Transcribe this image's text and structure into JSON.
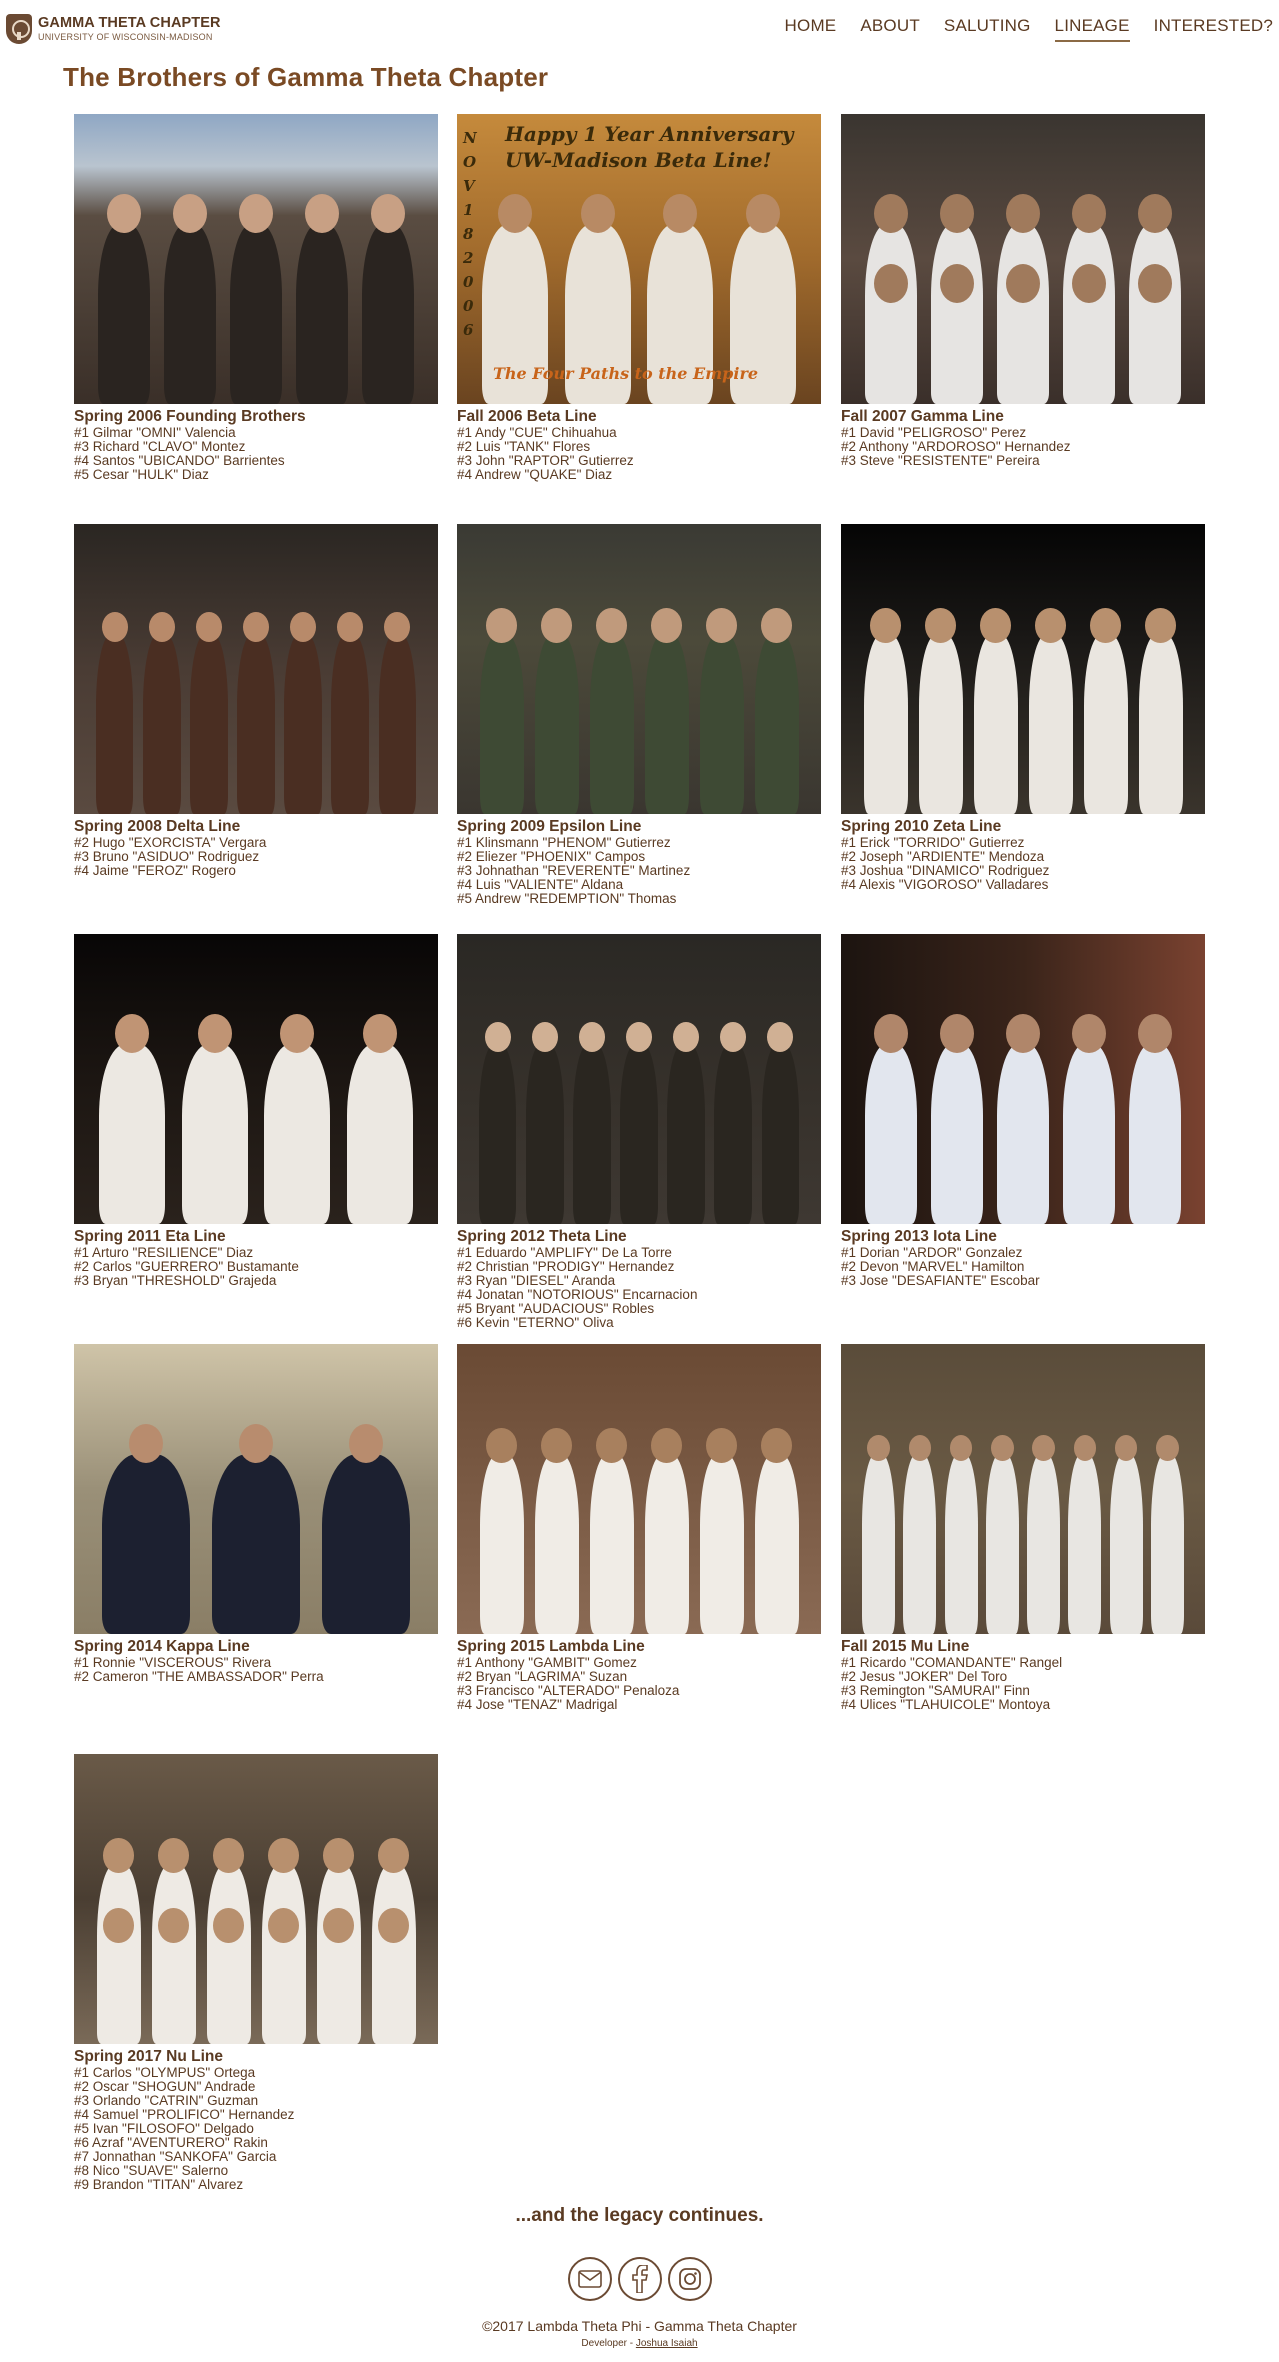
{
  "header": {
    "logo_title": "GAMMA THETA CHAPTER",
    "logo_subtitle": "UNIVERSITY OF WISCONSIN-MADISON",
    "nav": [
      {
        "label": "HOME"
      },
      {
        "label": "ABOUT"
      },
      {
        "label": "SALUTING"
      },
      {
        "label": "LINEAGE",
        "active": true
      },
      {
        "label": "INTERESTED?"
      }
    ]
  },
  "page_title": "The Brothers of Gamma Theta Chapter",
  "photo_text": {
    "banner_line1": "Happy 1 Year Anniversary",
    "banner_line2": "UW-Madison Beta Line!",
    "banner_side": "NOV 18 2006",
    "banner_bottom": "The Four Paths to the Empire"
  },
  "lines": [
    {
      "title": "Spring 2006 Founding Brothers",
      "members": [
        "#1 Gilmar \"OMNI\" Valencia",
        "#3 Richard \"CLAVO\" Montez",
        "#4 Santos \"UBICANDO\" Barrientes",
        "#5 Cesar \"HULK\" Diaz"
      ]
    },
    {
      "title": "Fall 2006 Beta Line",
      "members": [
        "#1 Andy \"CUE\" Chihuahua",
        "#2 Luis \"TANK\" Flores",
        "#3 John \"RAPTOR\" Gutierrez",
        "#4 Andrew \"QUAKE\" Diaz"
      ]
    },
    {
      "title": "Fall 2007 Gamma Line",
      "members": [
        "#1 David \"PELIGROSO\" Perez",
        "#2 Anthony \"ARDOROSO\" Hernandez",
        "#3 Steve \"RESISTENTE\" Pereira"
      ]
    },
    {
      "title": "Spring 2008 Delta Line",
      "members": [
        "#2 Hugo \"EXORCISTA\" Vergara",
        "#3 Bruno \"ASIDUO\" Rodriguez",
        "#4 Jaime \"FEROZ\" Rogero"
      ]
    },
    {
      "title": "Spring 2009 Epsilon Line",
      "members": [
        "#1 Klinsmann \"PHENOM\" Gutierrez",
        "#2 Eliezer \"PHOENIX\" Campos",
        "#3 Johnathan \"REVERENTE\" Martinez",
        "#4 Luis \"VALIENTE\" Aldana",
        "#5 Andrew \"REDEMPTION\" Thomas"
      ]
    },
    {
      "title": "Spring 2010 Zeta Line",
      "members": [
        "#1 Erick \"TORRIDO\" Gutierrez",
        "#2 Joseph \"ARDIENTE\" Mendoza",
        "#3 Joshua \"DINAMICO\" Rodriguez",
        "#4 Alexis \"VIGOROSO\" Valladares"
      ]
    },
    {
      "title": "Spring 2011 Eta Line",
      "members": [
        "#1 Arturo \"RESILIENCE\" Diaz",
        "#2 Carlos \"GUERRERO\" Bustamante",
        "#3 Bryan \"THRESHOLD\" Grajeda"
      ]
    },
    {
      "title": "Spring 2012 Theta Line",
      "members": [
        "#1 Eduardo \"AMPLIFY\" De La Torre",
        "#2 Christian \"PRODIGY\" Hernandez",
        "#3 Ryan \"DIESEL\" Aranda",
        "#4 Jonatan \"NOTORIOUS\" Encarnacion",
        "#5 Bryant \"AUDACIOUS\" Robles",
        "#6 Kevin \"ETERNO\" Oliva"
      ]
    },
    {
      "title": "Spring 2013 Iota Line",
      "members": [
        "#1 Dorian \"ARDOR\" Gonzalez",
        "#2 Devon \"MARVEL\" Hamilton",
        "#3 Jose \"DESAFIANTE\" Escobar"
      ]
    },
    {
      "title": "Spring 2014 Kappa Line",
      "members": [
        "#1 Ronnie \"VISCEROUS\" Rivera",
        "#2 Cameron \"THE AMBASSADOR\" Perra"
      ]
    },
    {
      "title": "Spring 2015 Lambda Line",
      "members": [
        "#1 Anthony \"GAMBIT\" Gomez",
        "#2 Bryan \"LAGRIMA\" Suzan",
        "#3 Francisco \"ALTERADO\" Penaloza",
        "#4 Jose \"TENAZ\" Madrigal"
      ]
    },
    {
      "title": "Fall 2015 Mu Line",
      "members": [
        "#1 Ricardo \"COMANDANTE\" Rangel",
        "#2 Jesus \"JOKER\" Del Toro",
        "#3 Remington \"SAMURAI\" Finn",
        "#4 Ulices \"TLAHUICOLE\" Montoya"
      ]
    },
    {
      "title": "Spring 2017 Nu Line",
      "members": [
        "#1 Carlos \"OLYMPUS\" Ortega",
        "#2 Oscar \"SHOGUN\" Andrade",
        "#3 Orlando \"CATRIN\" Guzman",
        "#4 Samuel \"PROLIFICO\" Hernandez",
        "#5 Ivan \"FILOSOFO\" Delgado",
        "#6 Azraf \"AVENTURERO\" Rakin",
        "#7 Jonnathan \"SANKOFA\" Garcia",
        "#8 Nico \"SUAVE\" Salerno",
        "#9 Brandon \"TITAN\" Alvarez"
      ]
    }
  ],
  "legacy_text": "...and the legacy continues.",
  "social": [
    {
      "icon": "mail-icon"
    },
    {
      "icon": "facebook-icon"
    },
    {
      "icon": "instagram-icon"
    }
  ],
  "footer": {
    "copyright": "©2017 Lambda Theta Phi - Gamma Theta Chapter",
    "developer_prefix": "Developer - ",
    "developer_name": "Joshua Isaiah"
  },
  "colors": {
    "text": "#5a3a22",
    "title": "#7a4a24",
    "accent": "#8b6a45"
  }
}
